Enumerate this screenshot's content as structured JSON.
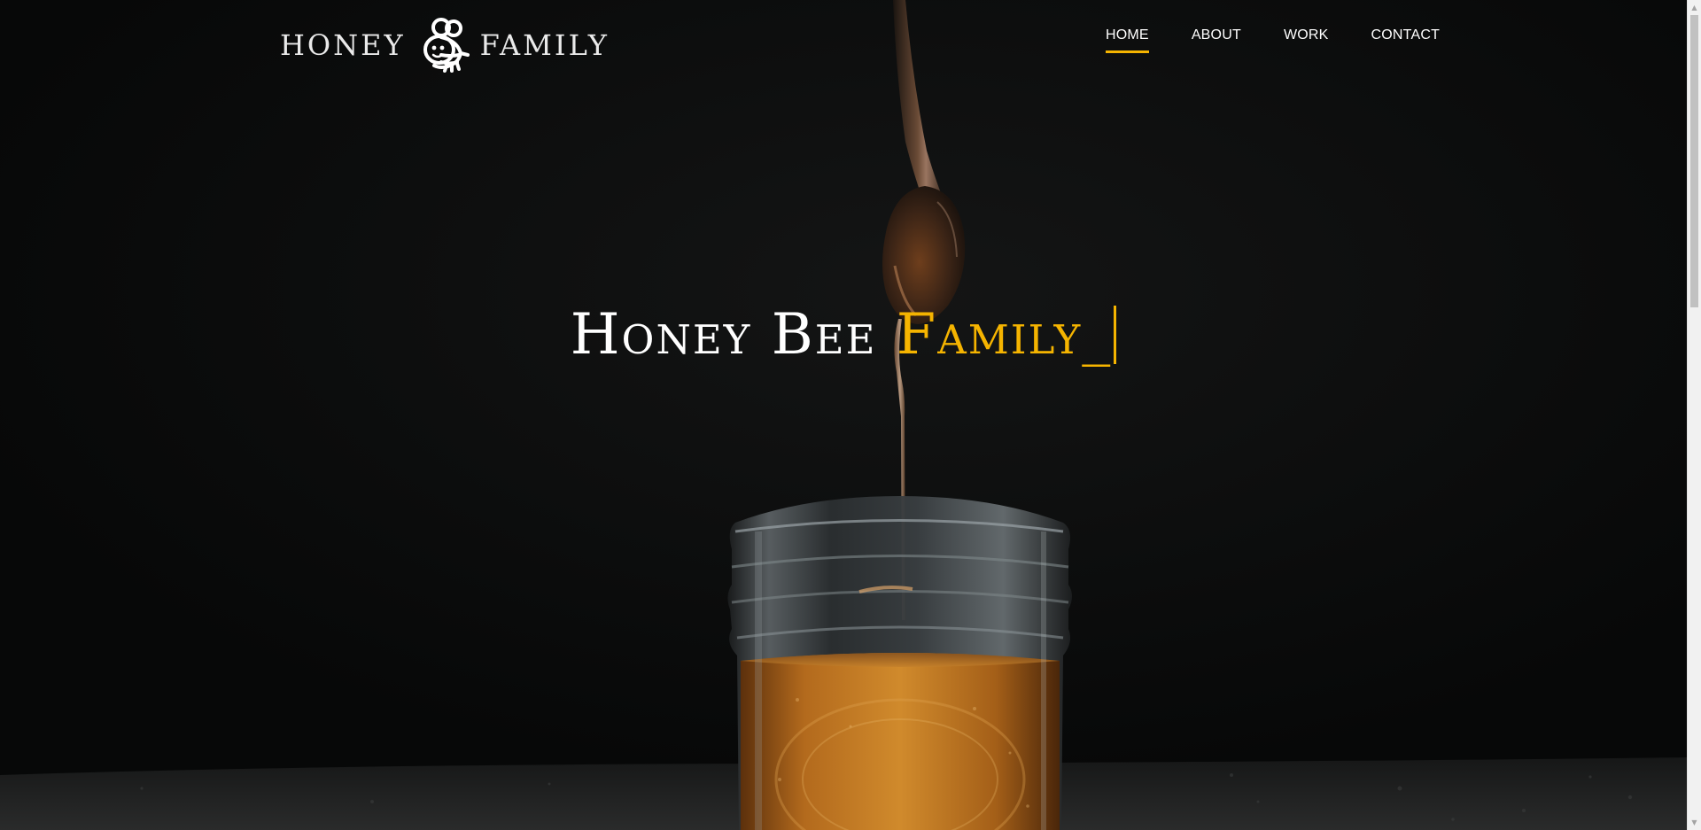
{
  "brand": {
    "word_left": "HONEY",
    "word_right": "FAMILY",
    "logo_icon": "bee-icon"
  },
  "nav": {
    "items": [
      {
        "label": "HOME",
        "active": true
      },
      {
        "label": "ABOUT",
        "active": false
      },
      {
        "label": "WORK",
        "active": false
      },
      {
        "label": "CONTACT",
        "active": false
      }
    ]
  },
  "hero": {
    "title_white": "Honey Bee",
    "title_gold": "Family",
    "title_suffix": "_"
  },
  "colors": {
    "accent": "#f5b400",
    "background": "#0a0b0b",
    "text": "#ffffff",
    "honey": "#c07a1a"
  }
}
